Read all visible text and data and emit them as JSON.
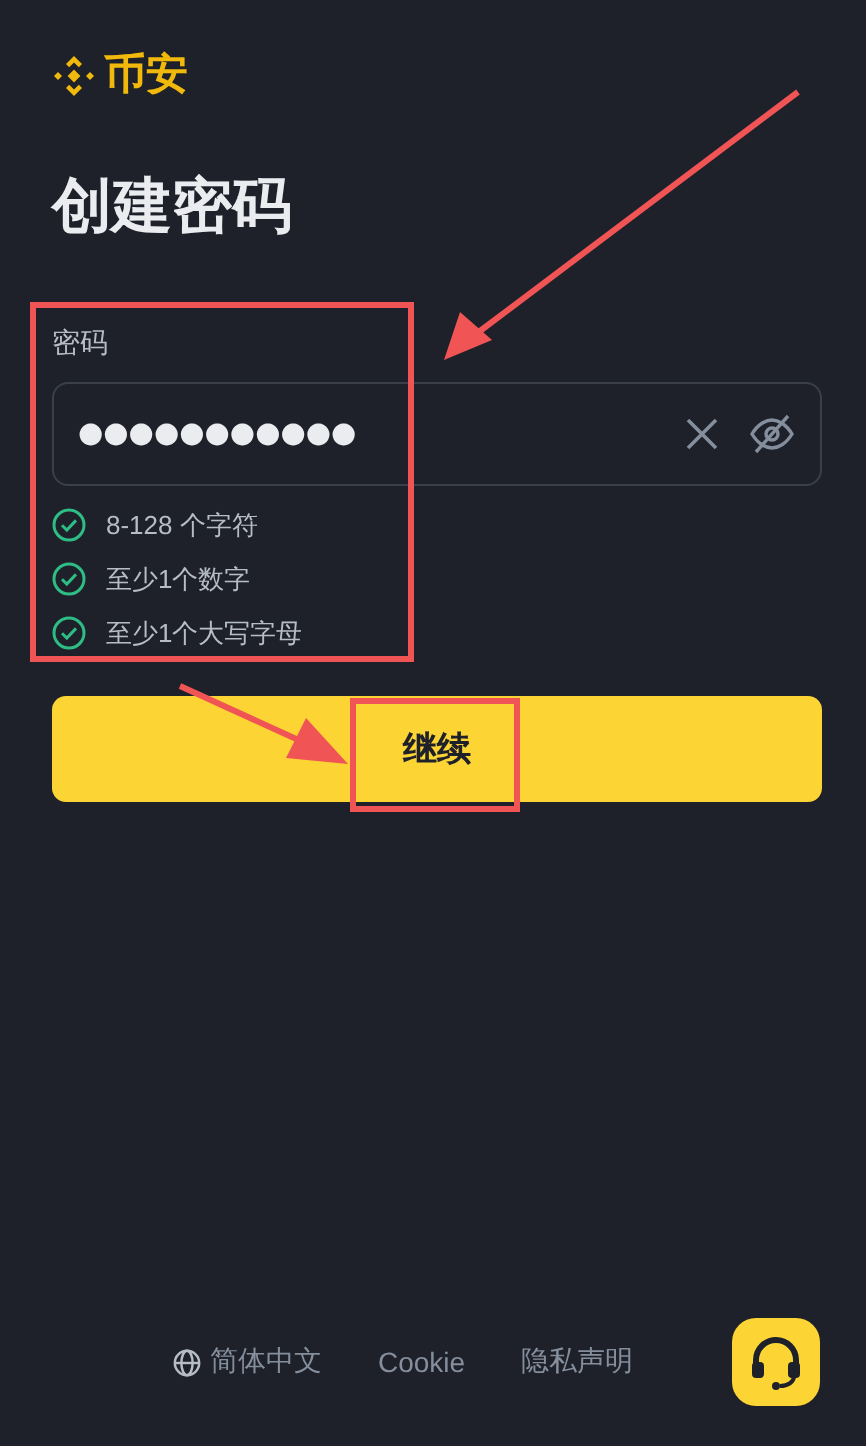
{
  "brand": {
    "name": "币安"
  },
  "title": "创建密码",
  "password": {
    "label": "密码",
    "value": "●●●●●●●●●●●",
    "visible": false
  },
  "rules": [
    {
      "text": "8-128 个字符",
      "met": true
    },
    {
      "text": "至少1个数字",
      "met": true
    },
    {
      "text": "至少1个大写字母",
      "met": true
    }
  ],
  "continue_button": {
    "label": "继续"
  },
  "footer": {
    "links": [
      {
        "kind": "language",
        "label": "简体中文"
      },
      {
        "kind": "link",
        "label": "Cookie"
      },
      {
        "kind": "link",
        "label": "隐私声明"
      }
    ]
  }
}
